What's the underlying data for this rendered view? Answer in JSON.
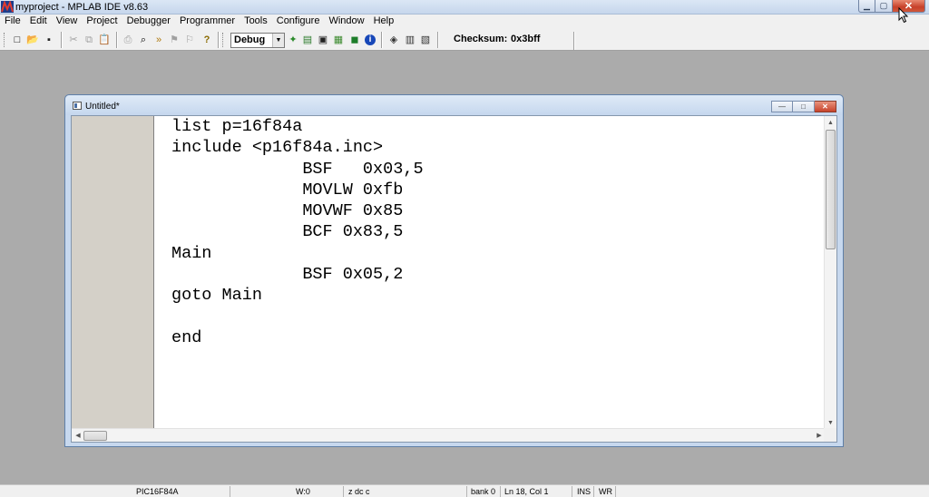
{
  "window": {
    "title": "myproject - MPLAB IDE v8.63",
    "min": "▁",
    "max": "▢",
    "close": "✕"
  },
  "menu": [
    "File",
    "Edit",
    "View",
    "Project",
    "Debugger",
    "Programmer",
    "Tools",
    "Configure",
    "Window",
    "Help"
  ],
  "toolbar": {
    "build_config": "Debug",
    "build_config_arrow": "▼",
    "checksum_label": "Checksum:",
    "checksum_value": "0x3bff",
    "icons": {
      "new": "□",
      "open": "📂",
      "save": "▪",
      "cut": "✂",
      "copy": "⧉",
      "paste": "📋",
      "print": "⎙",
      "find": "⌕",
      "find_next": "»",
      "bookmark": "⚑",
      "bookmark2": "⚐",
      "help": "?",
      "new_project": "✦",
      "open_project": "▤",
      "save_project": "▣",
      "build": "▦",
      "make": "◼",
      "info": "i",
      "tool1": "◈",
      "tool2": "▥",
      "tool3": "▧"
    }
  },
  "editor_window": {
    "title": "Untitled*",
    "min": "—",
    "max": "□",
    "close": "✕",
    "code_lines": [
      "list p=16f84a",
      "include <p16f84a.inc>",
      "             BSF   0x03,5",
      "             MOVLW 0xfb",
      "             MOVWF 0x85",
      "             BCF 0x83,5",
      "Main",
      "             BSF 0x05,2",
      "goto Main",
      "",
      "end"
    ],
    "scroll_up": "▲",
    "scroll_down": "▼",
    "scroll_left": "◀",
    "scroll_right": "▶"
  },
  "status": {
    "device": "PIC16F84A",
    "w_reg": "W:0",
    "flags": "z dc c",
    "bank": "bank 0",
    "position": "Ln 18, Col 1",
    "ins": "INS",
    "wr": "WR"
  }
}
